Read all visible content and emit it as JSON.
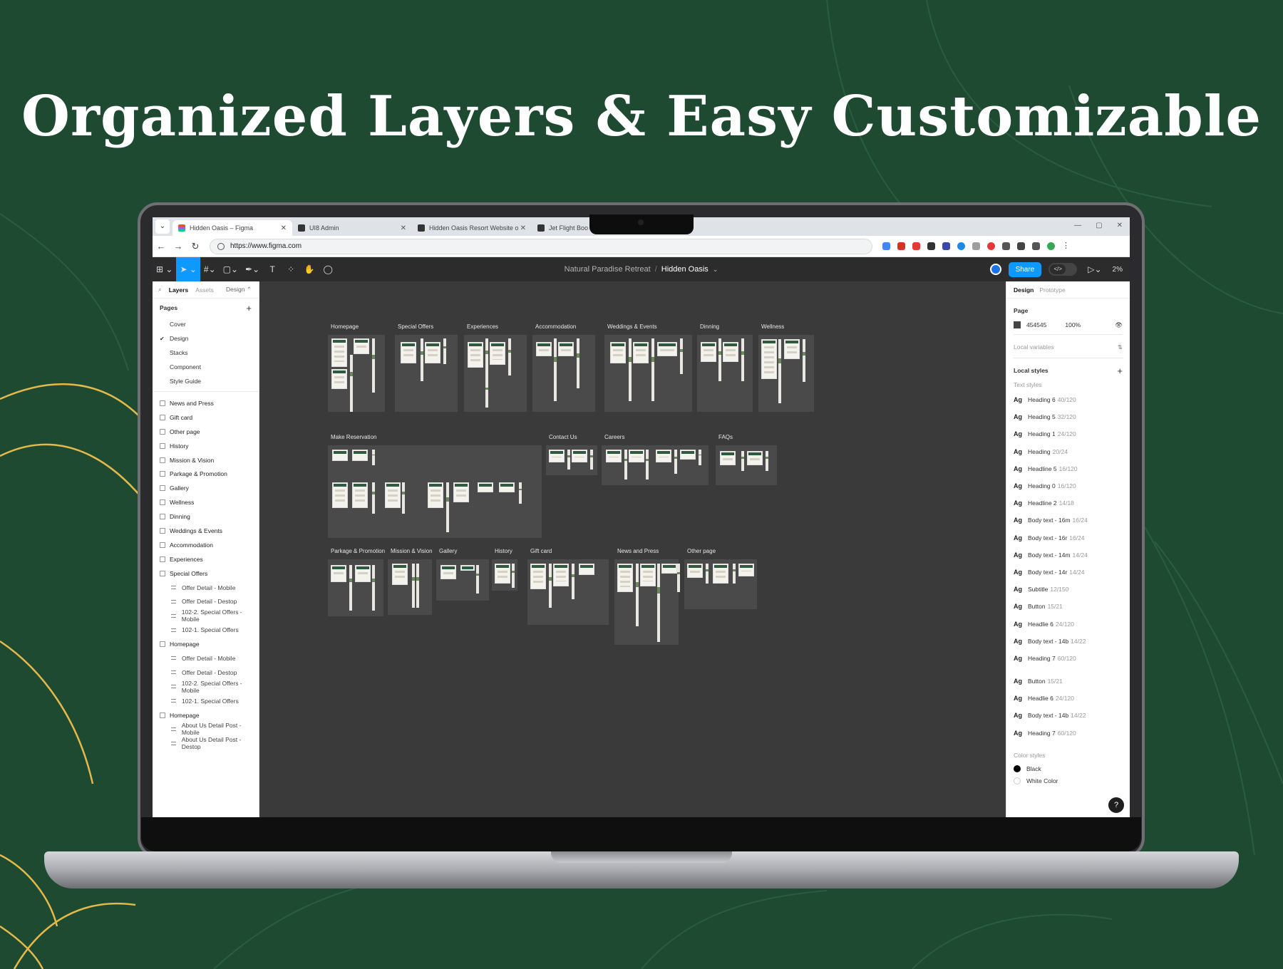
{
  "headline": "Organized Layers & Easy Customizable",
  "browser": {
    "tabs": [
      {
        "title": "Hidden Oasis – Figma",
        "active": true
      },
      {
        "title": "UI8 Admin",
        "active": false
      },
      {
        "title": "Hidden Oasis Resort Website o",
        "active": false
      },
      {
        "title": "Jet Flight Boo",
        "active": false
      }
    ],
    "url": "https://www.figma.com"
  },
  "figma": {
    "project": "Natural Paradise Retreat",
    "file": "Hidden Oasis",
    "share_label": "Share",
    "zoom": "2%"
  },
  "left_panel": {
    "tabs": {
      "layers": "Layers",
      "assets": "Assets",
      "page_dropdown": "Design"
    },
    "pages_label": "Pages",
    "pages": [
      "Cover",
      "Design",
      "Stacks",
      "Component",
      "Style Guide"
    ],
    "current_page": "Design",
    "layers": [
      {
        "name": "News and Press",
        "sub": false
      },
      {
        "name": "Gift card",
        "sub": false
      },
      {
        "name": "Other page",
        "sub": false
      },
      {
        "name": "History",
        "sub": false
      },
      {
        "name": "Mission & Vision",
        "sub": false
      },
      {
        "name": "Parkage & Promotion",
        "sub": false
      },
      {
        "name": "Gallery",
        "sub": false
      },
      {
        "name": "Wellness",
        "sub": false
      },
      {
        "name": "Dinning",
        "sub": false
      },
      {
        "name": "Weddings & Events",
        "sub": false
      },
      {
        "name": "Accommodation",
        "sub": false
      },
      {
        "name": "Experiences",
        "sub": false
      },
      {
        "name": "Special Offers",
        "sub": false
      },
      {
        "name": "Offer Detail - Mobile",
        "sub": true
      },
      {
        "name": "Offer Detail - Destop",
        "sub": true
      },
      {
        "name": "102-2. Special Offers - Mobile",
        "sub": true
      },
      {
        "name": "102-1. Special Offers",
        "sub": true
      },
      {
        "name": "Homepage",
        "sub": false
      },
      {
        "name": "Offer Detail - Mobile",
        "sub": true
      },
      {
        "name": "Offer Detail - Destop",
        "sub": true
      },
      {
        "name": "102-2. Special Offers - Mobile",
        "sub": true
      },
      {
        "name": "102-1. Special Offers",
        "sub": true
      },
      {
        "name": "Homepage",
        "sub": false
      },
      {
        "name": "About Us Detail Post - Mobile",
        "sub": true
      },
      {
        "name": "About Us Detail Post - Destop",
        "sub": true
      }
    ]
  },
  "canvas": {
    "background": "#3a3a3a",
    "sections": [
      "Homepage",
      "Special Offers",
      "Experiences",
      "Accommodation",
      "Weddings & Events",
      "Dinning",
      "Wellness",
      "Make Reservation",
      "Contact Us",
      "Careers",
      "FAQs",
      "Parkage & Promotion",
      "Mission & Vision",
      "Gallery",
      "History",
      "Gift card",
      "News and Press",
      "Other page"
    ]
  },
  "right_panel": {
    "tabs": {
      "design": "Design",
      "prototype": "Prototype"
    },
    "page_label": "Page",
    "page_color": "454545",
    "page_opacity": "100%",
    "local_variables": "Local variables",
    "local_styles": "Local styles",
    "text_styles_label": "Text styles",
    "text_styles": [
      {
        "name": "Heading 6",
        "size": "40/120"
      },
      {
        "name": "Heading 5",
        "size": "32/120"
      },
      {
        "name": "Heading 1",
        "size": "24/120"
      },
      {
        "name": "Heading",
        "size": "20/24"
      },
      {
        "name": "Headline 5",
        "size": "16/120"
      },
      {
        "name": "Heading 0",
        "size": "16/120"
      },
      {
        "name": "Headline 2",
        "size": "14/18"
      },
      {
        "name": "Body text - 16m",
        "size": "16/24"
      },
      {
        "name": "Body text - 16r",
        "size": "16/24"
      },
      {
        "name": "Body text - 14m",
        "size": "14/24"
      },
      {
        "name": "Body text - 14r",
        "size": "14/24"
      },
      {
        "name": "Subtitle",
        "size": "12/150"
      },
      {
        "name": "Button",
        "size": "15/21"
      },
      {
        "name": "Headlie 6",
        "size": "24/120"
      },
      {
        "name": "Body text - 14b",
        "size": "14/22"
      },
      {
        "name": "Heading 7",
        "size": "60/120"
      }
    ],
    "text_styles_2": [
      {
        "name": "Button",
        "size": "15/21"
      },
      {
        "name": "Headlie 6",
        "size": "24/120"
      },
      {
        "name": "Body text - 14b",
        "size": "14/22"
      },
      {
        "name": "Heading 7",
        "size": "60/120"
      }
    ],
    "color_styles_label": "Color styles",
    "color_styles": [
      "Black",
      "White Color"
    ]
  },
  "colors": {
    "background": "#1f4a32",
    "accent": "#0d99ff",
    "decor_gold": "#e3b94a"
  }
}
